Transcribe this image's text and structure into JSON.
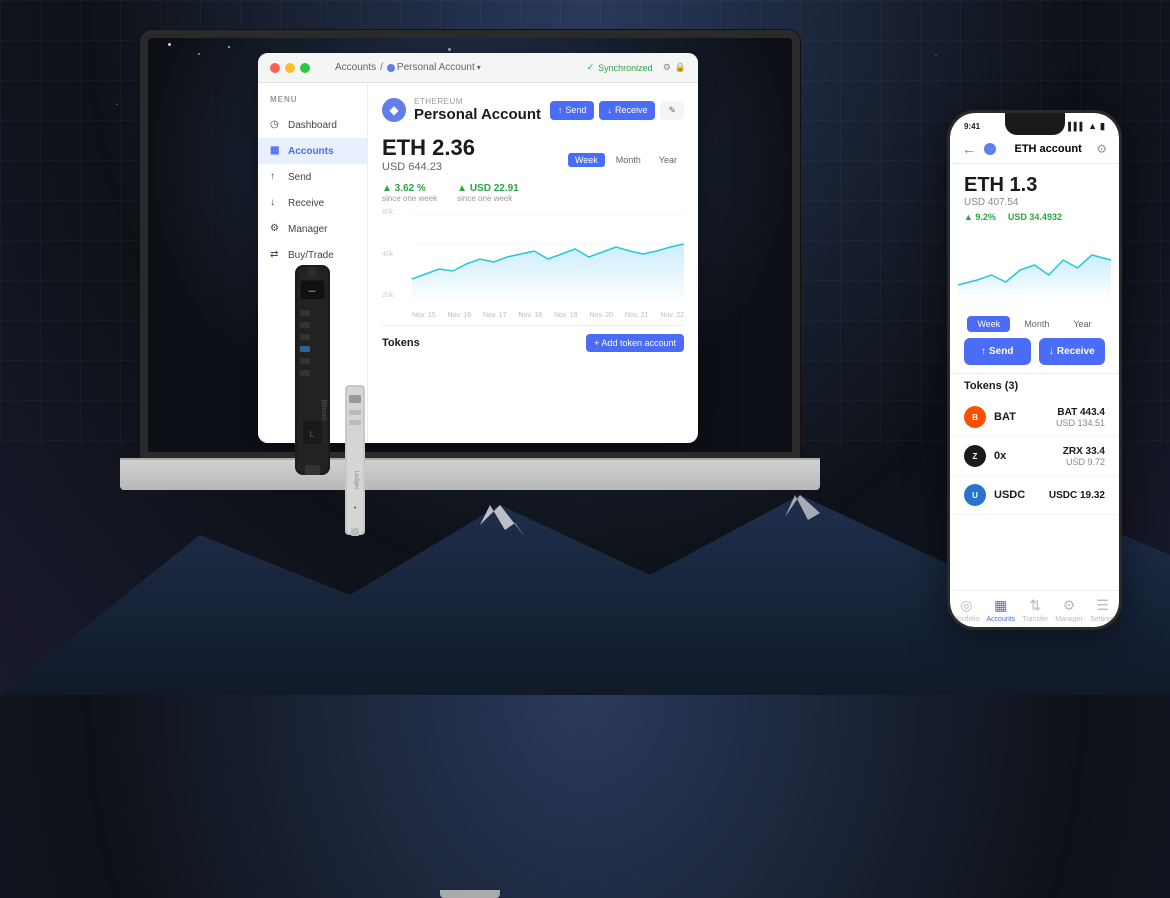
{
  "background": {
    "color": "#0d1117"
  },
  "laptop": {
    "window": {
      "titlebar": {
        "breadcrumb_accounts": "Accounts",
        "breadcrumb_separator": "/",
        "breadcrumb_account": "Personal Account",
        "sync_label": "Synchronized"
      },
      "sidebar": {
        "menu_label": "MENU",
        "items": [
          {
            "id": "dashboard",
            "label": "Dashboard",
            "icon": "◷"
          },
          {
            "id": "accounts",
            "label": "Accounts",
            "icon": "▦",
            "active": true
          },
          {
            "id": "send",
            "label": "Send",
            "icon": "↑"
          },
          {
            "id": "receive",
            "label": "Receive",
            "icon": "↓"
          },
          {
            "id": "manager",
            "label": "Manager",
            "icon": "⚙"
          },
          {
            "id": "buytrade",
            "label": "Buy/Trade",
            "icon": "⇄"
          }
        ]
      },
      "main": {
        "account_subtitle": "ETHEREUM",
        "account_name": "Personal Account",
        "balance_eth": "ETH 2.36",
        "balance_usd": "USD 644.23",
        "chart_periods": [
          "Week",
          "Month",
          "Year"
        ],
        "active_period": "Week",
        "stats": [
          {
            "value": "▲ 3.62 %",
            "label": "since one week"
          },
          {
            "value": "▲ USD 22.91",
            "label": "since one week"
          }
        ],
        "chart_y_labels": [
          "60k",
          "40k",
          "20k"
        ],
        "chart_x_labels": [
          "Nov. 15",
          "Nov. 16",
          "Nov. 17",
          "Nov. 18",
          "Nov. 19",
          "Nov. 20",
          "Nov. 21",
          "Nov. 22"
        ],
        "tokens_label": "Tokens",
        "add_token_btn": "+ Add token account",
        "send_btn": "Send",
        "receive_btn": "Receive"
      }
    }
  },
  "phone": {
    "status_bar": {
      "time": "9:41",
      "signal": "▌▌▌",
      "wifi": "▲",
      "battery": "■"
    },
    "header": {
      "title": "ETH account",
      "back_icon": "←",
      "settings_icon": "⚙"
    },
    "balance": {
      "eth": "ETH 1.3",
      "usd": "USD 407.54"
    },
    "stats": [
      {
        "value": "▲ 9.2%"
      },
      {
        "value": "USD 34.4932"
      }
    ],
    "period_tabs": [
      "Week",
      "Month",
      "Year"
    ],
    "active_period": "Week",
    "send_btn": "Send",
    "receive_btn": "Receive",
    "tokens_header": "Tokens (3)",
    "tokens": [
      {
        "symbol": "B",
        "name": "BAT",
        "color": "#ff5000",
        "amount": "BAT 443.4",
        "usd": "USD 134.51"
      },
      {
        "symbol": "Z",
        "name": "0x",
        "color": "#1a1a1a",
        "amount": "ZRX 33.4",
        "usd": "USD 9.72"
      },
      {
        "symbol": "U",
        "name": "USDC",
        "color": "#2775ca",
        "amount": "USDC 19.32",
        "usd": ""
      }
    ],
    "nav": [
      {
        "id": "portfolio",
        "label": "Portfolio",
        "icon": "◎"
      },
      {
        "id": "accounts",
        "label": "Accounts",
        "icon": "▦",
        "active": true
      },
      {
        "id": "transfer",
        "label": "Transfer",
        "icon": "⇅"
      },
      {
        "id": "manager",
        "label": "Manager",
        "icon": "⚙"
      },
      {
        "id": "settings",
        "label": "Settings",
        "icon": "☰"
      }
    ]
  },
  "icons": {
    "eth_symbol": "◆",
    "arrow_up": "↑",
    "arrow_down": "↓",
    "check": "✓",
    "plus": "+",
    "edit": "✎",
    "lock": "🔒"
  }
}
